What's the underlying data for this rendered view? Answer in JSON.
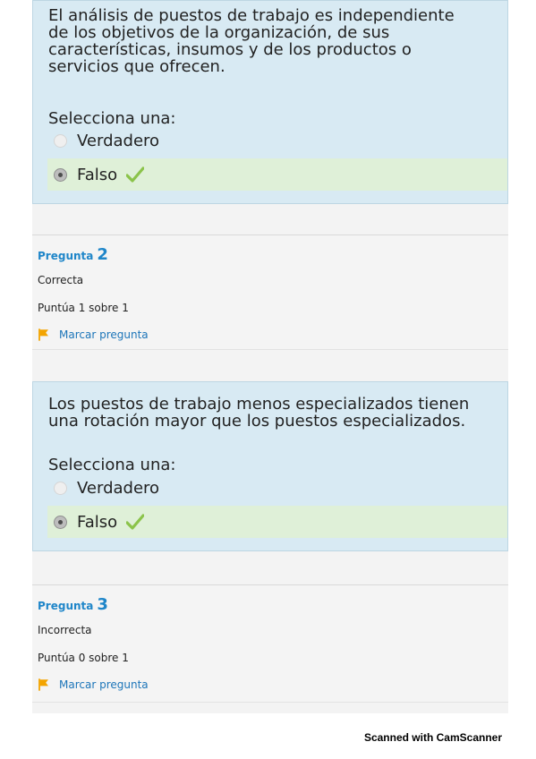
{
  "question1": {
    "text": "El análisis de puestos de trabajo es independiente de los objetivos de la organización, de sus características, insumos y de los productos o servicios que ofrecen.",
    "prompt": "Selecciona una:",
    "options": [
      {
        "label": "Verdadero",
        "selected": false,
        "correct": false
      },
      {
        "label": "Falso",
        "selected": true,
        "correct": true
      }
    ]
  },
  "question2_info": {
    "label": "Pregunta",
    "number": "2",
    "status": "Correcta",
    "score": "Puntúa 1 sobre 1",
    "flag_label": "Marcar pregunta"
  },
  "question2": {
    "text": "Los puestos de trabajo menos especializados tienen una rotación mayor que los puestos especializados.",
    "prompt": "Selecciona una:",
    "options": [
      {
        "label": "Verdadero",
        "selected": false,
        "correct": false
      },
      {
        "label": "Falso",
        "selected": true,
        "correct": true
      }
    ]
  },
  "question3_info": {
    "label": "Pregunta",
    "number": "3",
    "status": "Incorrecta",
    "score": "Puntúa 0 sobre 1",
    "flag_label": "Marcar pregunta"
  },
  "footer": {
    "text": "Scanned with CamScanner"
  },
  "icons": {
    "checkmark": "check-icon",
    "flag": "flag-icon"
  },
  "colors": {
    "question_background": "#d8eaf3",
    "correct_answer_background": "#dff0d8",
    "link_blue": "#1c75b9",
    "question_number_blue": "#1f86c9",
    "check_green": "#8bc34a",
    "flag_orange": "#f3a400"
  }
}
